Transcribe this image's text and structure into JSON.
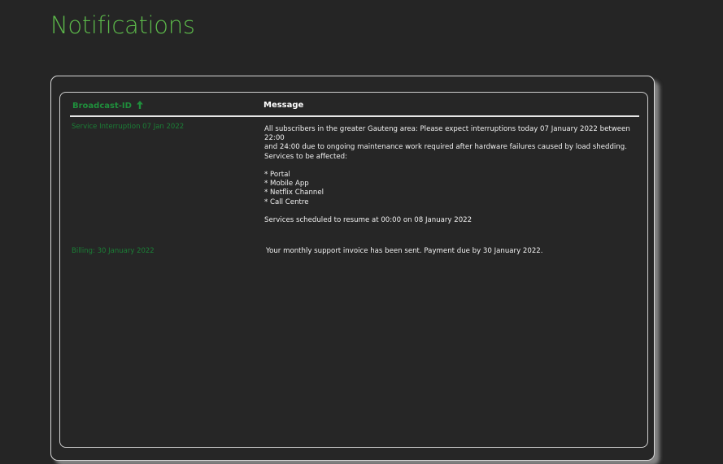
{
  "page": {
    "title": "Notifications"
  },
  "table": {
    "columns": {
      "broadcast_id": "Broadcast-ID",
      "message": "Message"
    },
    "rows": [
      {
        "id": "Service Interruption 07 Jan 2022",
        "message_lines": [
          "All subscribers in the greater Gauteng area: Please expect interruptions today 07 January 2022 between 22:00",
          "and 24:00 due to ongoing maintenance work required after hardware failures caused by load shedding.",
          "Services to be affected:",
          "",
          "* Portal",
          "* Mobile App",
          "* Netflix Channel",
          "* Call Centre",
          "",
          "Services scheduled to resume at 00:00 on 08 January 2022"
        ]
      },
      {
        "id": "Billing: 30 January 2022",
        "message_lines": [
          "Your monthly support invoice has been sent. Payment due by 30 January 2022."
        ]
      }
    ]
  },
  "colors": {
    "title": "#5cb84a",
    "broadcast_id_header": "#1f8f3c",
    "broadcast_id_cell": "#1b7f36",
    "background": "#252525"
  },
  "icons": {
    "sort": "arrow-up-icon"
  }
}
